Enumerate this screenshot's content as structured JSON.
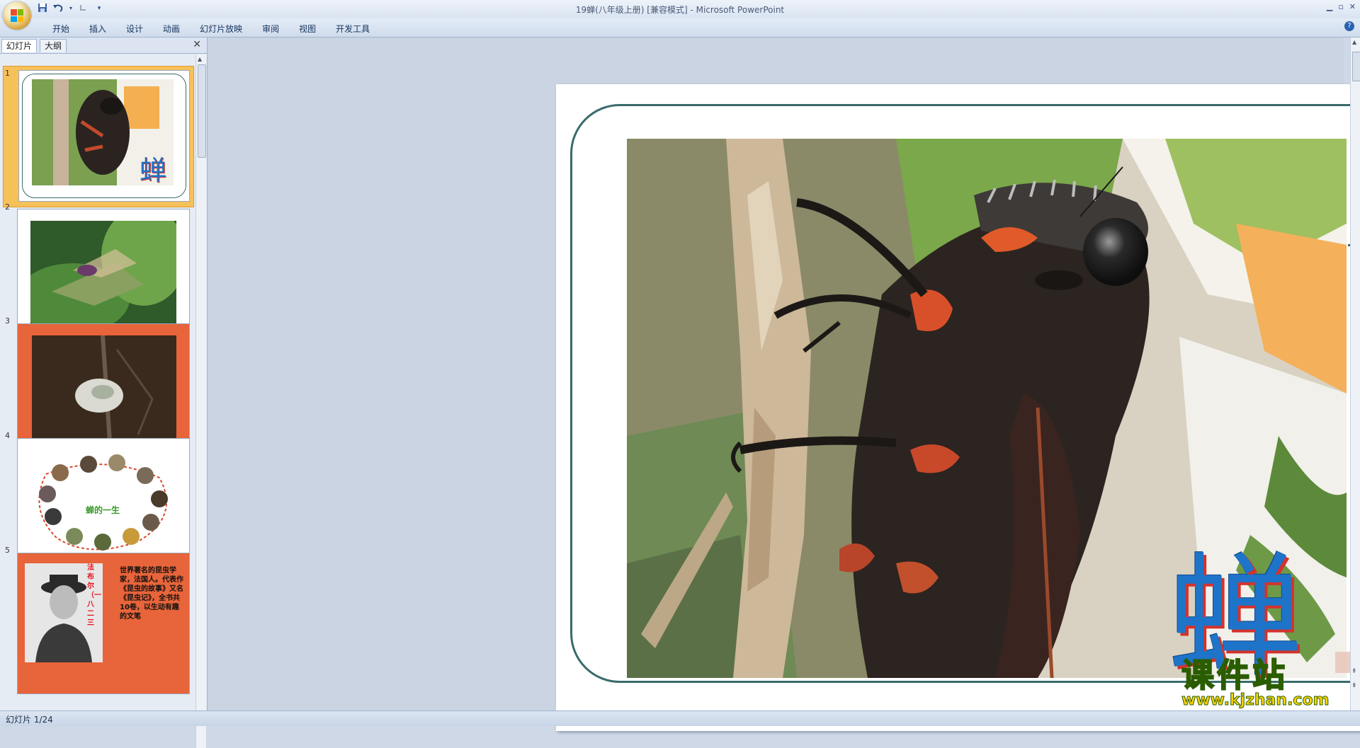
{
  "window": {
    "title": "19蝉(八年级上册) [兼容模式] - Microsoft PowerPoint"
  },
  "ribbon": {
    "tabs": [
      "开始",
      "插入",
      "设计",
      "动画",
      "幻灯片放映",
      "审阅",
      "视图",
      "开发工具"
    ]
  },
  "left_panel": {
    "tab_slides": "幻灯片",
    "tab_outline": "大纲",
    "thumbnails": [
      {
        "number": "1",
        "caption": "蝉"
      },
      {
        "number": "2"
      },
      {
        "number": "3"
      },
      {
        "number": "4",
        "caption": "蝉的一生"
      },
      {
        "number": "5",
        "name_text": "法布尔（一八二三",
        "body_text": "世界著名的昆虫学家，法国人。代表作《昆虫的故事》又名《昆虫记》，全书共10卷，以生动有趣的文笔"
      }
    ]
  },
  "slide": {
    "title_char": "蝉"
  },
  "status": {
    "slide_counter": "幻灯片 1/24"
  },
  "watermark": {
    "text": "课件站",
    "url": "www.kjzhan.com"
  },
  "colors": {
    "frame": "#3a6b6b",
    "title_char": "#1e74c8",
    "title_shadow": "#d4322c",
    "selection": "#f7c15a"
  }
}
